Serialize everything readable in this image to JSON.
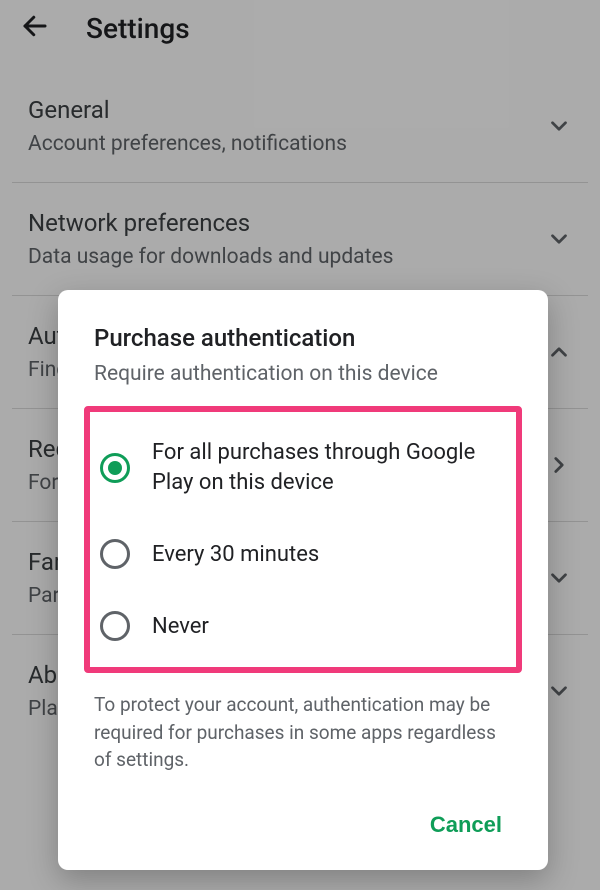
{
  "header": {
    "title": "Settings"
  },
  "rows": [
    {
      "primary": "General",
      "secondary": "Account preferences, notifications",
      "chevron": "down"
    },
    {
      "primary": "Network preferences",
      "secondary": "Data usage for downloads and updates",
      "chevron": "down"
    },
    {
      "primary": "Authentication",
      "secondary": "Fingerprint, purchase authentication",
      "chevron": "up"
    },
    {
      "primary": "Require authentication",
      "secondary": "For all purchases through Google",
      "chevron": "right"
    },
    {
      "primary": "Family",
      "secondary": "Parental controls",
      "chevron": "down"
    },
    {
      "primary": "About",
      "secondary": "Play Store version",
      "chevron": "down"
    }
  ],
  "dialog": {
    "title": "Purchase authentication",
    "subtitle": "Require authentication on this device",
    "options": [
      {
        "label": "For all purchases through Google Play on this device",
        "selected": true
      },
      {
        "label": "Every 30 minutes",
        "selected": false
      },
      {
        "label": "Never",
        "selected": false
      }
    ],
    "footnote": "To protect your account, authentication may be required for purchases in some apps regardless of settings.",
    "cancel_label": "Cancel"
  },
  "colors": {
    "accent": "#0f9d58",
    "highlight": "#f03a7a"
  }
}
